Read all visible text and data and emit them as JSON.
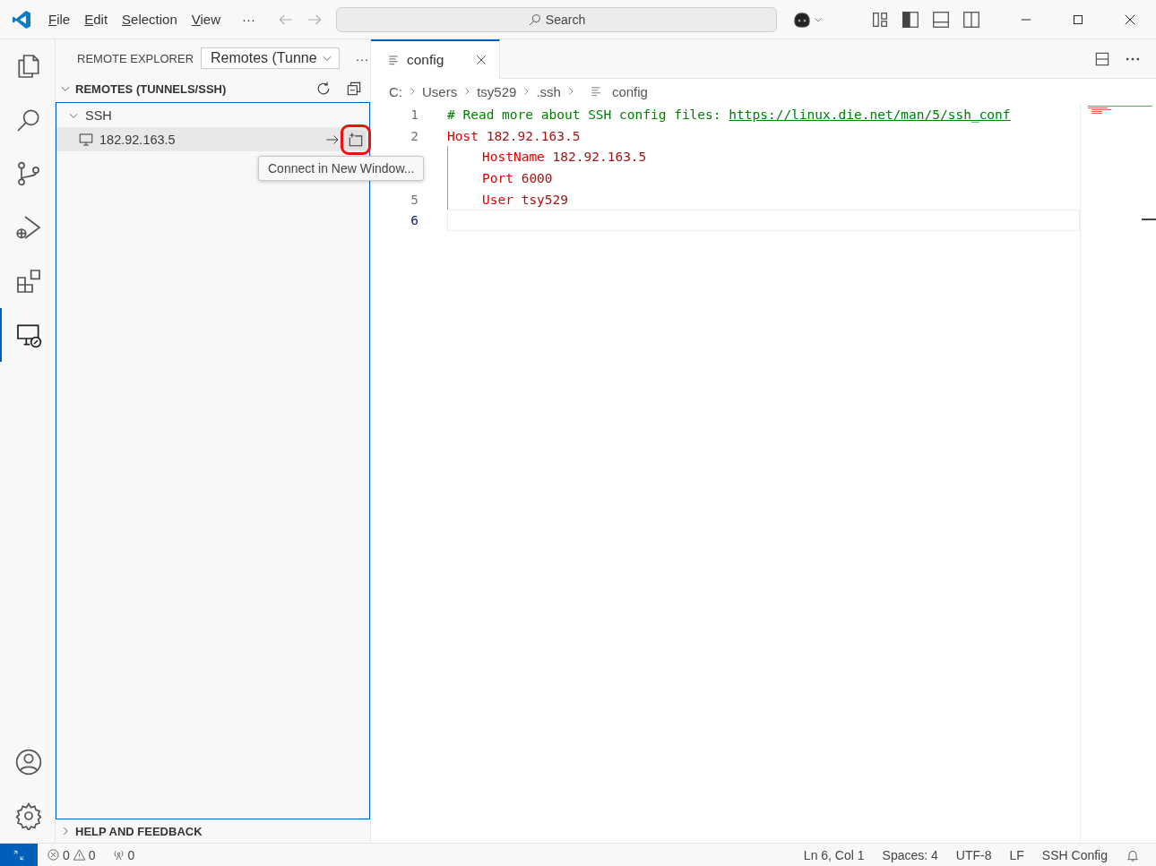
{
  "titlebar": {
    "menu": [
      "File",
      "Edit",
      "Selection",
      "View"
    ],
    "more": "···",
    "search": {
      "placeholder": "Search"
    }
  },
  "activity_bar": {
    "items": [
      {
        "kind": "files",
        "selected": false
      },
      {
        "kind": "search",
        "selected": false
      },
      {
        "kind": "source-control",
        "selected": false
      },
      {
        "kind": "debug",
        "selected": false
      },
      {
        "kind": "extensions",
        "selected": false
      },
      {
        "kind": "remote",
        "selected": true
      }
    ],
    "bottom": [
      {
        "kind": "account"
      },
      {
        "kind": "settings"
      }
    ]
  },
  "sidebar": {
    "title": "REMOTE EXPLORER",
    "dropdown": "Remotes (Tunne",
    "more": "···",
    "sections": [
      {
        "title": "REMOTES (TUNNELS/SSH)",
        "expanded": true,
        "tree": [
          {
            "label": "SSH",
            "expanded": true,
            "children": [
              {
                "label": "182.92.163.5",
                "selected": true
              }
            ]
          }
        ]
      },
      {
        "title": "HELP AND FEEDBACK",
        "expanded": false
      }
    ],
    "tooltip": "Connect in New Window..."
  },
  "editor": {
    "tabs": [
      {
        "label": "config",
        "selected": true
      }
    ],
    "breadcrumbs": [
      "C:",
      "Users",
      "tsy529",
      ".ssh",
      "config"
    ],
    "lines": [
      {
        "number": "1",
        "tokens": [
          {
            "kind": "comment",
            "text": "# Read more about SSH config files: "
          },
          {
            "kind": "link",
            "text": "https://linux.die.net/man/5/ssh_conf"
          }
        ]
      },
      {
        "number": "2",
        "tokens": [
          {
            "kind": "keyword",
            "text": "Host"
          },
          {
            "kind": "value",
            "text": " 182.92.163.5"
          }
        ]
      },
      {
        "indent": true,
        "tokens": [
          {
            "kind": "keyword",
            "text": "HostName"
          },
          {
            "kind": "value",
            "text": " 182.92.163.5"
          }
        ]
      },
      {
        "indent": true,
        "tokens": [
          {
            "kind": "keyword",
            "text": "Port"
          },
          {
            "kind": "value",
            "text": " 6000"
          }
        ]
      },
      {
        "number": "5",
        "indent": true,
        "tokens": [
          {
            "kind": "keyword",
            "text": "User"
          },
          {
            "kind": "value",
            "text": " tsy529"
          }
        ]
      },
      {
        "number": "6",
        "current": true
      }
    ]
  },
  "status_bar": {
    "errors": "0",
    "warnings": "0",
    "ports": "0",
    "right": [
      "Ln 6, Col 1",
      "Spaces: 4",
      "UTF-8",
      "LF",
      "SSH Config"
    ]
  }
}
